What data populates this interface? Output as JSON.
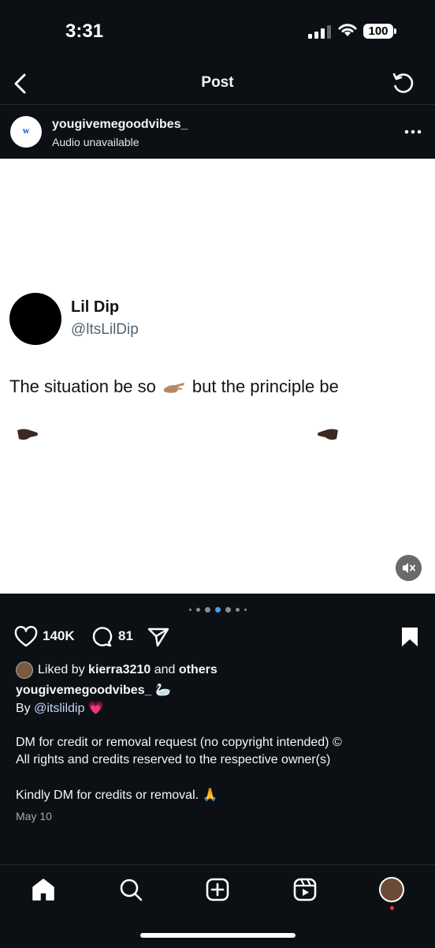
{
  "status_bar": {
    "time": "3:31",
    "battery": "100"
  },
  "header": {
    "title": "Post"
  },
  "post": {
    "avatar_letter": "w",
    "username": "yougivemegoodvibes_",
    "audio_status": "Audio unavailable"
  },
  "tweet": {
    "name": "Lil Dip",
    "handle": "@ltsLilDip",
    "text_before": "The situation be so",
    "text_after": "but the principle be"
  },
  "carousel": {
    "count": 7,
    "active": 4
  },
  "actions": {
    "likes": "140K",
    "comments": "81"
  },
  "liked_by": {
    "prefix": "Liked by",
    "user": "kierra3210",
    "middle": "and",
    "others": "others"
  },
  "caption": {
    "username": "yougivemegoodvibes_",
    "swan": "🦢",
    "by_prefix": "By",
    "by_handle": "@itslildip",
    "heart": "💗",
    "line1": "DM for credit or removal request (no copyright intended) ©",
    "line2": "All rights and credits reserved to the respective owner(s)",
    "line3": "Kindly DM for credits or removal. 🙏",
    "date": "May 10"
  },
  "icons": {
    "back": "chevron-left-icon",
    "refresh": "refresh-icon",
    "more": "more-horizontal-icon",
    "like": "heart-icon",
    "comment": "comment-icon",
    "share": "send-icon",
    "save": "bookmark-icon",
    "mute": "muted-speaker-icon"
  },
  "colors": {
    "background": "#0c1014",
    "link": "#c8d5f5",
    "active_dot": "#4a9cf0"
  }
}
